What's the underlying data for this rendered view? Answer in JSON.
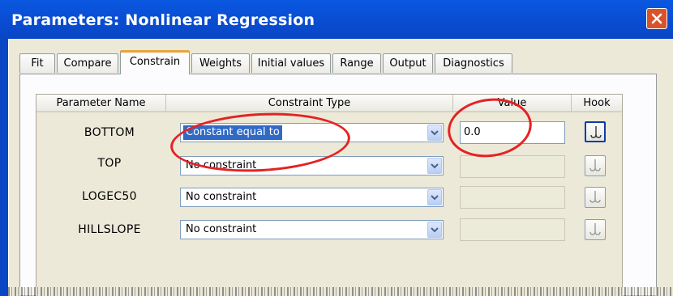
{
  "window": {
    "title": "Parameters: Nonlinear Regression"
  },
  "tabs": [
    {
      "label": "Fit"
    },
    {
      "label": "Compare"
    },
    {
      "label": "Constrain"
    },
    {
      "label": "Weights"
    },
    {
      "label": "Initial values"
    },
    {
      "label": "Range"
    },
    {
      "label": "Output"
    },
    {
      "label": "Diagnostics"
    }
  ],
  "active_tab": "Constrain",
  "grid": {
    "headers": {
      "parameter": "Parameter Name",
      "constraint": "Constraint Type",
      "value": "Value",
      "hook": "Hook"
    },
    "rows": [
      {
        "name": "BOTTOM",
        "constraint": "Constant equal to",
        "value": "0.0"
      },
      {
        "name": "TOP",
        "constraint": "No constraint",
        "value": ""
      },
      {
        "name": "LOGEC50",
        "constraint": "No constraint",
        "value": ""
      },
      {
        "name": "HILLSLOPE",
        "constraint": "No constraint",
        "value": ""
      }
    ]
  },
  "colors": {
    "titlebar": "#0846c4",
    "selection": "#316ac5",
    "annotation": "#e42222",
    "active_tab_accent": "#e8a33c"
  },
  "icons": {
    "close": "close-icon",
    "dropdown": "chevron-down-icon",
    "hook": "hook-icon"
  }
}
